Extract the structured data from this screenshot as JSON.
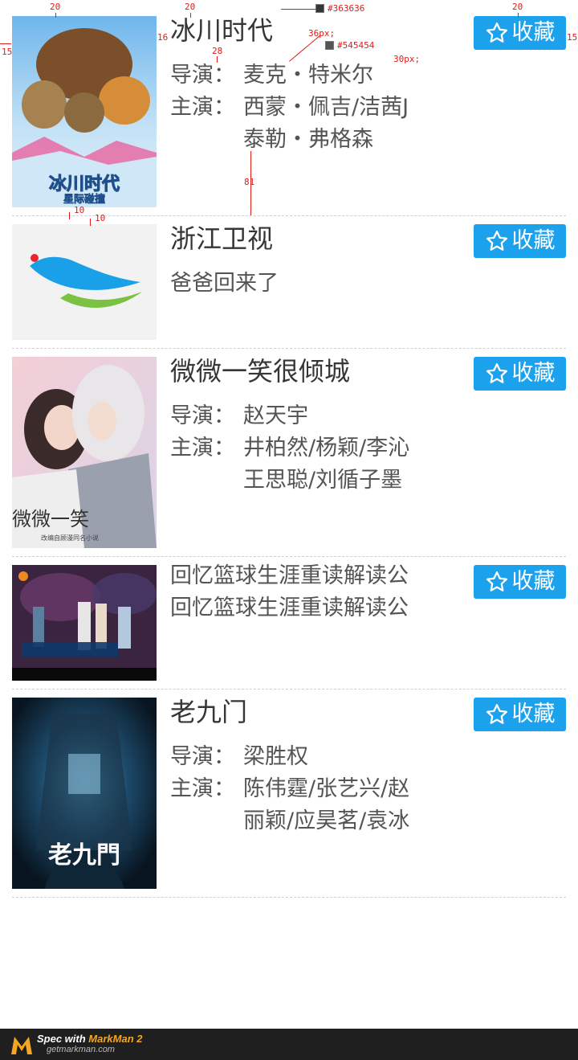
{
  "favorite_label": "收藏",
  "items": [
    {
      "title": "冰川时代",
      "director_label": "导演：",
      "director": "麦克・特米尔",
      "cast_label": "主演：",
      "cast_line1": "西蒙・佩吉/洁茜J",
      "cast_line2": "泰勒・弗格森"
    },
    {
      "title": "浙江卫视",
      "subtitle": "爸爸回来了"
    },
    {
      "title": "微微一笑很倾城",
      "director_label": "导演：",
      "director": "赵天宇",
      "cast_label": "主演：",
      "cast_line1": "井柏然/杨颖/李沁",
      "cast_line2": "王思聪/刘循子墨"
    },
    {
      "line1": "回忆篮球生涯重读解读公",
      "line2": "回忆篮球生涯重读解读公"
    },
    {
      "title": "老九门",
      "director_label": "导演：",
      "director": "梁胜权",
      "cast_label": "主演：",
      "cast_line1": "陈伟霆/张艺兴/赵",
      "cast_line2": "丽颖/应昊茗/袁冰"
    }
  ],
  "poster_text": {
    "ice_age_title": "冰川时代",
    "ice_age_sub": "星际碰撞",
    "weiwei": "微微一笑",
    "weiwei_sub": "改编自顾漫同名小说",
    "laojiumen": "老九門"
  },
  "annotations": {
    "color_title": "#363636",
    "color_meta": "#545454",
    "size_title": "36px;",
    "size_meta": "30px;",
    "d_top_left": "20",
    "d_top_mid": "20",
    "d_top_right": "20",
    "d_left": "15",
    "d_gap": "16",
    "d_right": "15",
    "d_title_meta": "28",
    "d_row_bottom": "81",
    "d_pad_a": "10",
    "d_pad_b": "10"
  },
  "footer": {
    "brand_prefix": "Spec with ",
    "brand_name": "MarkMan 2",
    "site": "getmarkman.com"
  },
  "colors": {
    "accent": "#1ca1ed",
    "title": "#363636",
    "meta": "#545454",
    "divider": "#cfcfcf"
  }
}
